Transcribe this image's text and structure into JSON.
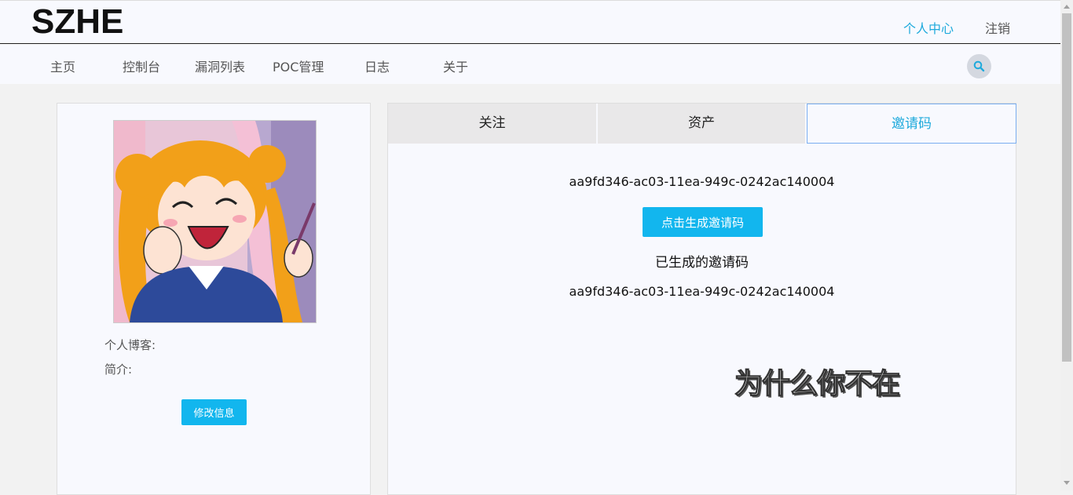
{
  "header": {
    "logo": "SZHE",
    "profile_link": "个人中心",
    "logout_link": "注销"
  },
  "nav": {
    "items": [
      "主页",
      "控制台",
      "漏洞列表",
      "POC管理",
      "日志",
      "关于"
    ]
  },
  "profile": {
    "blog_label": "个人博客:",
    "intro_label": "简介:",
    "edit_button": "修改信息"
  },
  "tabs": [
    {
      "label": "关注",
      "active": false
    },
    {
      "label": "资产",
      "active": false
    },
    {
      "label": "邀请码",
      "active": true
    }
  ],
  "invite": {
    "current_code": "aa9fd346-ac03-11ea-949c-0242ac140004",
    "generate_button": "点击生成邀请码",
    "generated_heading": "已生成的邀请码",
    "generated_codes": [
      "aa9fd346-ac03-11ea-949c-0242ac140004"
    ]
  },
  "overlay_text": "为什么你不在",
  "colors": {
    "accent": "#1eaadc",
    "button": "#12b6ee"
  }
}
